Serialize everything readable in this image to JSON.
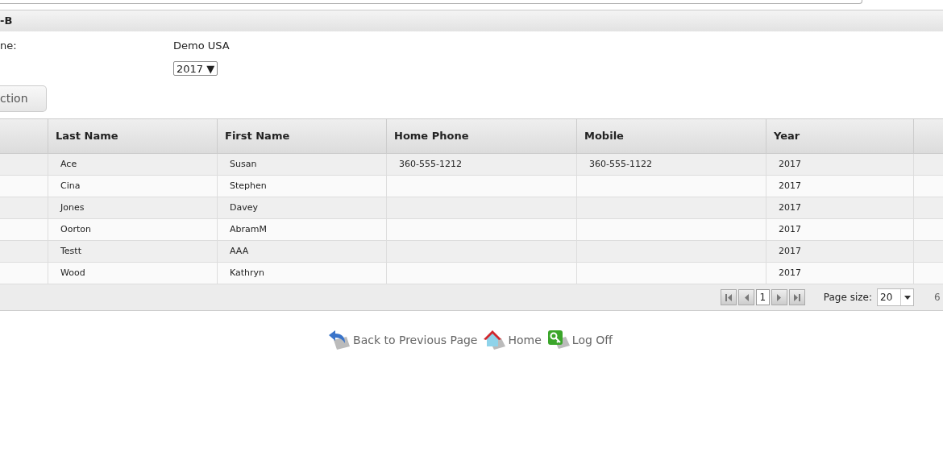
{
  "section": {
    "title": "-B"
  },
  "form": {
    "name_label": "ne:",
    "name_value": "Demo USA",
    "year_select": "2017 ▼",
    "action_button": "ction"
  },
  "table": {
    "columns": [
      "Last Name",
      "First Name",
      "Home Phone",
      "Mobile",
      "Year"
    ],
    "rows": [
      [
        "Ace",
        "Susan",
        "360-555-1212",
        "360-555-1122",
        "2017"
      ],
      [
        "Cina",
        "Stephen",
        "",
        "",
        "2017"
      ],
      [
        "Jones",
        "Davey",
        "",
        "",
        "2017"
      ],
      [
        "Oorton",
        "AbramM",
        "",
        "",
        "2017"
      ],
      [
        "Testt",
        "AAA",
        "",
        "",
        "2017"
      ],
      [
        "Wood",
        "Kathryn",
        "",
        "",
        "2017"
      ]
    ]
  },
  "pager": {
    "pages": [
      {
        "label": "1",
        "selected": true
      }
    ],
    "page_size_label": "Page size:",
    "page_size": "20",
    "count": "6"
  },
  "footer_links": [
    {
      "kind": "back",
      "label": "Back to Previous Page"
    },
    {
      "kind": "home",
      "label": "Home"
    },
    {
      "kind": "logoff",
      "label": "Log Off"
    }
  ]
}
